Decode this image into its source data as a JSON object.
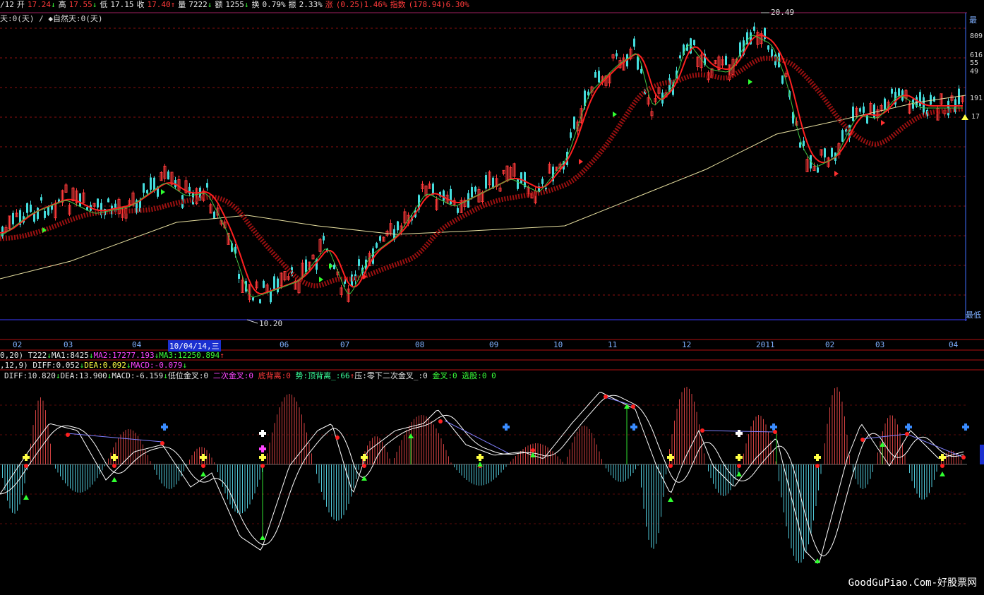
{
  "header": {
    "date_frag": "/12",
    "open_label": "开",
    "open": "17.24",
    "high_label": "高",
    "high": "17.55",
    "low_label": "低",
    "low": "17.15",
    "close_label": "收",
    "close": "17.40",
    "vol_label": "量",
    "vol": "7222",
    "amt_label": "额",
    "amt": "1255",
    "turn_label": "换",
    "turn": "0.79%",
    "amp_label": "振",
    "amp": "2.33%",
    "chg_label": "涨",
    "chg": "(0.25)1.46%",
    "idx_label": "指数",
    "idx": "(178.94)6.30%"
  },
  "subheader": {
    "text1": "天:0(天)",
    "sep": "/",
    "text2": "◆自然天:0(天)"
  },
  "price_panel": {
    "high_mark": "20.49",
    "low_mark": "10.20",
    "max_label": "最",
    "min_label": "最低",
    "right_axis": [
      "809",
      "616",
      "55",
      "49",
      "191",
      "17"
    ]
  },
  "date_axis": {
    "labels": [
      "02",
      "03",
      "04",
      "06",
      "07",
      "08",
      "09",
      "10",
      "11",
      "12",
      "2011",
      "02",
      "03",
      "04"
    ],
    "cursor": "10/04/14,三"
  },
  "vol_line": {
    "prefix": "0,20)",
    "t_label": "T222",
    "ma1": "MA1:8425",
    "ma2": "MA2:17277.193",
    "ma3": "MA3:12250.894"
  },
  "macd_line": {
    "prefix": ",12,9)",
    "diff": "DIFF:0.052",
    "dea": "DEA:0.092",
    "macd": "MACD:-0.079"
  },
  "ind_line": {
    "diff": "DIFF:10.820",
    "dea": "DEA:13.900",
    "macd": "MACD:-6.159",
    "low_cross": "低位金叉:0",
    "second_cross": "二次金叉:0",
    "bottom_div": "底背离:0",
    "trend": "势:顶背离_:66",
    "press": "压:零下二次金叉_:0",
    "gold": "金叉:0",
    "pick": "选股:0 0"
  },
  "watermark": "GoodGuPiao.Com-好股票网",
  "colors": {
    "up": "#ff3a3a",
    "down": "#44dddd",
    "ma_thick": "#9a1010",
    "ma_long": "#e8e0a0",
    "grid": "#8a1010"
  }
}
